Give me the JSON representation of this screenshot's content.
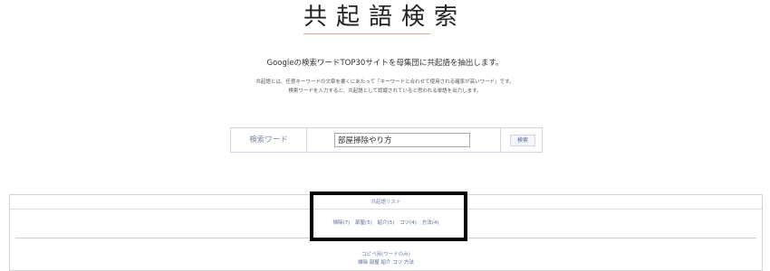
{
  "header": {
    "logo_text": "共起語検索"
  },
  "intro": {
    "tagline": "Googleの検索ワードTOP30サイトを母集団に共起語を抽出します。",
    "desc_line1": "共起語とは、任意キーワードの文章を書くにあたって「キーワードと合わせて使用される確率が高いワード」です。",
    "desc_line2": "検索ワードを入力すると、共起語として認識されていると思われる単語を出力します。"
  },
  "search": {
    "label": "検索ワード",
    "value": "部屋掃除やり方",
    "button_label": "検索"
  },
  "results": {
    "title": "共起語リスト",
    "words": [
      "掃除(7)",
      "部屋(5)",
      "紹介(5)",
      "コツ(4)",
      "方法(4)"
    ],
    "copy_title": "コピペ用(ワードのみ)",
    "copy_words": "掃除 部屋 紹介 コツ 方法"
  },
  "colors": {
    "accent": "#5a6a9a",
    "highlight": "#000000"
  }
}
